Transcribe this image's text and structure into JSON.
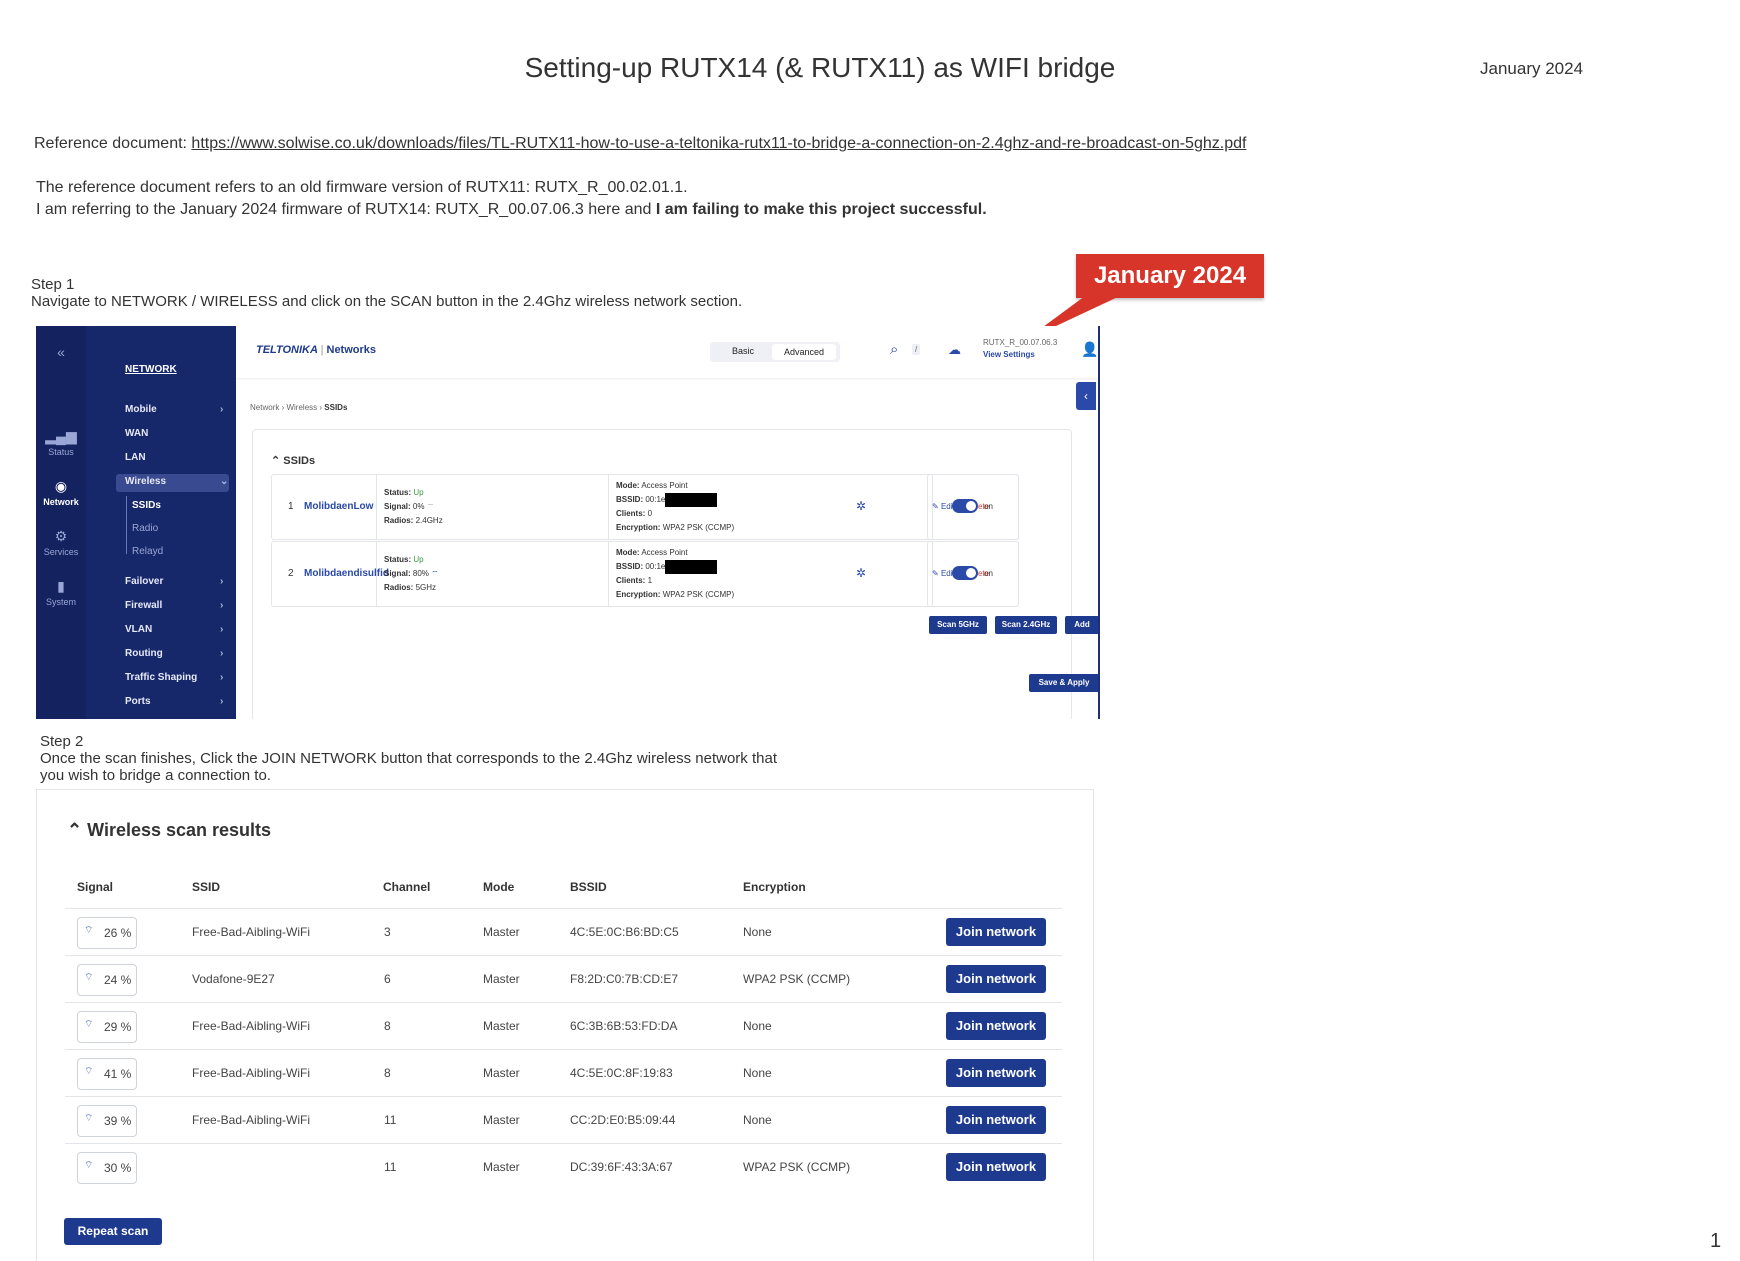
{
  "document": {
    "title": "Setting-up RUTX14 (& RUTX11) as WIFI bridge",
    "date": "January 2024",
    "reference_label": "Reference document: ",
    "reference_url": "https://www.solwise.co.uk/downloads/files/TL-RUTX11-how-to-use-a-teltonika-rutx11-to-bridge-a-connection-on-2.4ghz-and-re-broadcast-on-5ghz.pdf",
    "para_line1": "The reference document refers to an old firmware version of RUTX11: RUTX_R_00.02.01.1.",
    "para_line2_a": "I am referring to the January 2024 firmware of RUTX14: RUTX_R_00.07.06.3 here and ",
    "para_line2_b": "I am failing to make this project successful.",
    "page_number": "1"
  },
  "step1": {
    "heading": "Step 1",
    "text": "Navigate to NETWORK / WIRELESS and click on the SCAN button in the 2.4Ghz wireless network section.",
    "callout": "January 2024"
  },
  "screenshot1": {
    "rail": [
      {
        "label": "Status",
        "icon": "signal-bars-icon"
      },
      {
        "label": "Network",
        "icon": "globe-icon"
      },
      {
        "label": "Services",
        "icon": "gear-icon"
      },
      {
        "label": "System",
        "icon": "file-icon"
      }
    ],
    "collapse_glyph": "«",
    "nav_heading": "NETWORK",
    "nav_items": [
      "Mobile",
      "WAN",
      "LAN",
      "Wireless",
      "Failover",
      "Firewall",
      "VLAN",
      "Routing",
      "Traffic Shaping",
      "Ports"
    ],
    "nav_sub_items": [
      "SSIDs",
      "Radio",
      "Relayd"
    ],
    "logo_brand": "TELTONIKA",
    "logo_sep": "|",
    "logo_suffix": "Networks",
    "mode_basic": "Basic",
    "mode_advanced": "Advanced",
    "search_shortcut": "/",
    "firmware": "RUTX_R_00.07.06.3",
    "view_settings": "View Settings",
    "breadcrumb": [
      "Network",
      "Wireless",
      "SSIDs"
    ],
    "section_title": "SSIDs",
    "ssids": [
      {
        "num": "1",
        "name": "MolibdaenLow",
        "status": "Up",
        "signal": "0%",
        "radios": "2.4GHz",
        "mode": "Access Point",
        "bssid": "00:1e",
        "clients": "0",
        "encryption": "WPA2 PSK (CCMP)",
        "toggle": "on"
      },
      {
        "num": "2",
        "name": "Molibdaendisulfid",
        "status": "Up",
        "signal": "80%",
        "radios": "5GHz",
        "mode": "Access Point",
        "bssid": "00:1e",
        "clients": "1",
        "encryption": "WPA2 PSK (CCMP)",
        "toggle": "on"
      }
    ],
    "labels": {
      "status": "Status:",
      "signal": "Signal:",
      "radios": "Radios:",
      "mode": "Mode:",
      "bssid": "BSSID:",
      "clients": "Clients:",
      "encryption": "Encryption:"
    },
    "edit": "Edit",
    "delete": "Delete",
    "btn_scan5": "Scan 5GHz",
    "btn_scan24": "Scan 2.4GHz",
    "btn_add": "Add",
    "btn_save": "Save & Apply"
  },
  "step2": {
    "heading": "Step 2",
    "text_line1": "Once the scan finishes, Click the JOIN NETWORK button that corresponds to the 2.4Ghz wireless network that",
    "text_line2": "you wish to bridge a connection to."
  },
  "scan_results": {
    "title": "Wireless scan results",
    "columns": [
      "Signal",
      "SSID",
      "Channel",
      "Mode",
      "BSSID",
      "Encryption"
    ],
    "rows": [
      {
        "signal": "26 %",
        "ssid": "Free-Bad-Aibling-WiFi",
        "channel": "3",
        "mode": "Master",
        "bssid": "4C:5E:0C:B6:BD:C5",
        "encryption": "None"
      },
      {
        "signal": "24 %",
        "ssid": "Vodafone-9E27",
        "channel": "6",
        "mode": "Master",
        "bssid": "F8:2D:C0:7B:CD:E7",
        "encryption": "WPA2 PSK (CCMP)"
      },
      {
        "signal": "29 %",
        "ssid": "Free-Bad-Aibling-WiFi",
        "channel": "8",
        "mode": "Master",
        "bssid": "6C:3B:6B:53:FD:DA",
        "encryption": "None"
      },
      {
        "signal": "41 %",
        "ssid": "Free-Bad-Aibling-WiFi",
        "channel": "8",
        "mode": "Master",
        "bssid": "4C:5E:0C:8F:19:83",
        "encryption": "None"
      },
      {
        "signal": "39 %",
        "ssid": "Free-Bad-Aibling-WiFi",
        "channel": "11",
        "mode": "Master",
        "bssid": "CC:2D:E0:B5:09:44",
        "encryption": "None"
      },
      {
        "signal": "30 %",
        "ssid": "",
        "channel": "11",
        "mode": "Master",
        "bssid": "DC:39:6F:43:3A:67",
        "encryption": "WPA2 PSK (CCMP)"
      }
    ],
    "join_label": "Join network",
    "repeat_label": "Repeat scan"
  },
  "colors": {
    "accent": "#1e3a8f",
    "nav_bg": "#16276a",
    "callout": "#d7342a"
  }
}
